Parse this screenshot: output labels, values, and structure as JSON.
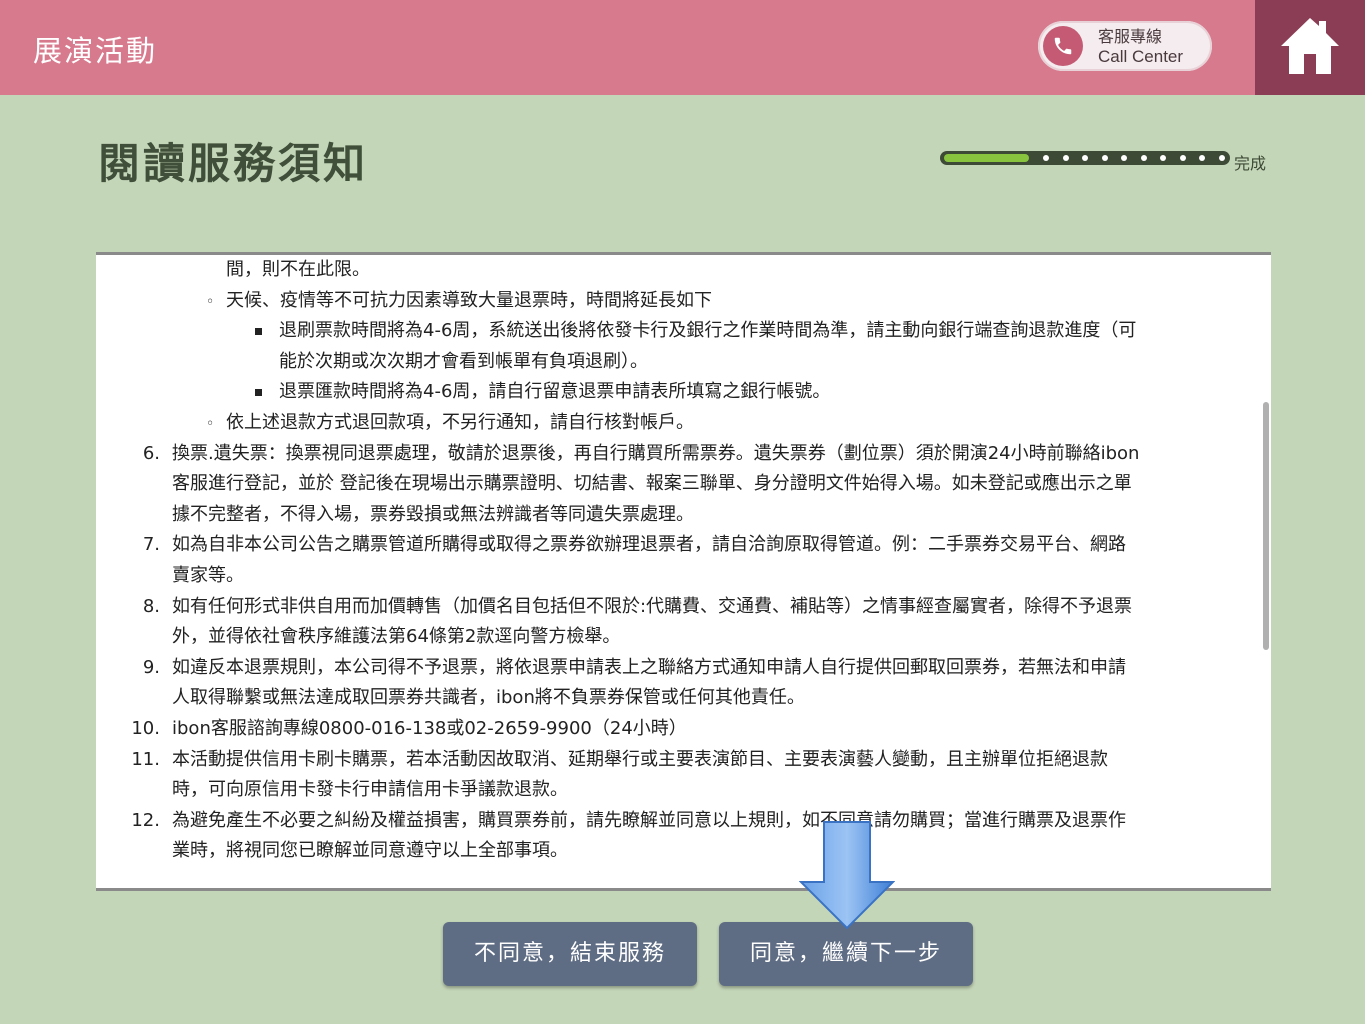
{
  "header": {
    "title": "展演活動",
    "call_center_zh": "客服專線",
    "call_center_en": "Call Center"
  },
  "page": {
    "title": "閱讀服務須知",
    "progress_label": "完成",
    "progress_fraction": 0.1
  },
  "notice": {
    "lines": [
      {
        "indent": "cont2",
        "text": "間，則不在此限。"
      },
      {
        "indent": "sub",
        "text": "天候、疫情等不可抗力因素導致大量退票時，時間將延長如下"
      },
      {
        "indent": "subsub",
        "text": "退刷票款時間將為4-6周，系統送出後將依發卡行及銀行之作業時間為準，請主動向銀行端查詢退款進度（可"
      },
      {
        "indent": "cont3",
        "text": "能於次期或次次期才會看到帳單有負項退刷）。"
      },
      {
        "indent": "subsub",
        "text": "退票匯款時間將為4-6周，請自行留意退票申請表所填寫之銀行帳號。"
      },
      {
        "indent": "sub",
        "text": "依上述退款方式退回款項，不另行通知，請自行核對帳戶。"
      },
      {
        "indent": "item",
        "num": "6.",
        "text": "換票.遺失票：換票視同退票處理，敬請於退票後，再自行購買所需票券。遺失票券（劃位票）須於開演24小時前聯絡ibon"
      },
      {
        "indent": "cont1",
        "text": "客服進行登記，並於  登記後在現場出示購票證明、切結書、報案三聯單、身分證明文件始得入場。如未登記或應出示之單"
      },
      {
        "indent": "cont1",
        "text": "據不完整者，不得入場，票券毀損或無法辨識者等同遺失票處理。"
      },
      {
        "indent": "item",
        "num": "7.",
        "text": "如為自非本公司公告之購票管道所購得或取得之票券欲辦理退票者，請自洽詢原取得管道。例：二手票券交易平台、網路"
      },
      {
        "indent": "cont1",
        "text": "賣家等。"
      },
      {
        "indent": "item",
        "num": "8.",
        "text": "如有任何形式非供自用而加價轉售（加價名目包括但不限於:代購費、交通費、補貼等）之情事經查屬實者，除得不予退票"
      },
      {
        "indent": "cont1",
        "text": "外，並得依社會秩序維護法第64條第2款逕向警方檢舉。"
      },
      {
        "indent": "item",
        "num": "9.",
        "text": "如違反本退票規則，本公司得不予退票，將依退票申請表上之聯絡方式通知申請人自行提供回郵取回票券，若無法和申請"
      },
      {
        "indent": "cont1",
        "text": "人取得聯繫或無法達成取回票券共識者，ibon將不負票券保管或任何其他責任。"
      },
      {
        "indent": "item",
        "num": "10.",
        "text": "ibon客服諮詢專線0800-016-138或02-2659-9900（24小時）"
      },
      {
        "indent": "item",
        "num": "11.",
        "text": "本活動提供信用卡刷卡購票，若本活動因故取消、延期舉行或主要表演節目、主要表演藝人變動，且主辦單位拒絕退款"
      },
      {
        "indent": "cont1",
        "text": "時，可向原信用卡發卡行申請信用卡爭議款退款。"
      },
      {
        "indent": "item",
        "num": "12.",
        "text": "為避免產生不必要之糾紛及權益損害，購買票券前，請先瞭解並同意以上規則，如不同意請勿購買；當進行購票及退票作"
      },
      {
        "indent": "cont1",
        "text": "業時，將視同您已瞭解並同意遵守以上全部事項。"
      }
    ]
  },
  "buttons": {
    "disagree": "不同意，結束服務",
    "agree": "同意，繼續下一步"
  }
}
